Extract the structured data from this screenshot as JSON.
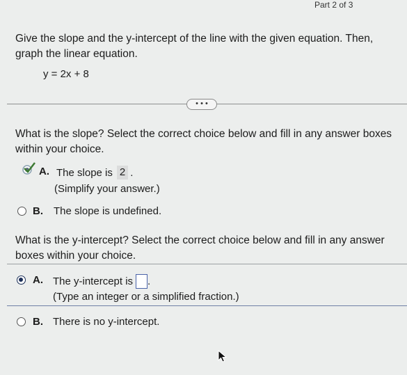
{
  "header": {
    "part": "Part 2 of 3"
  },
  "question": {
    "prompt": "Give the slope and the y-intercept of the line with the given equation. Then, graph the linear equation.",
    "equation": "y = 2x + 8"
  },
  "more_button": "• • •",
  "slope": {
    "prompt": "What is the slope? Select the correct choice below and fill in any answer boxes within your choice.",
    "choices": [
      {
        "letter": "A.",
        "text": "The slope is",
        "value": "2",
        "suffix": ".",
        "hint": "(Simplify your answer.)"
      },
      {
        "letter": "B.",
        "text": "The slope is undefined."
      }
    ]
  },
  "intercept": {
    "prompt": "What is the y-intercept? Select the correct choice below and fill in any answer boxes within your choice.",
    "choices": [
      {
        "letter": "A.",
        "text": "The y-intercept is",
        "value": "",
        "suffix": ".",
        "hint": "(Type an integer or a simplified fraction.)"
      },
      {
        "letter": "B.",
        "text": "There is no y-intercept."
      }
    ]
  }
}
